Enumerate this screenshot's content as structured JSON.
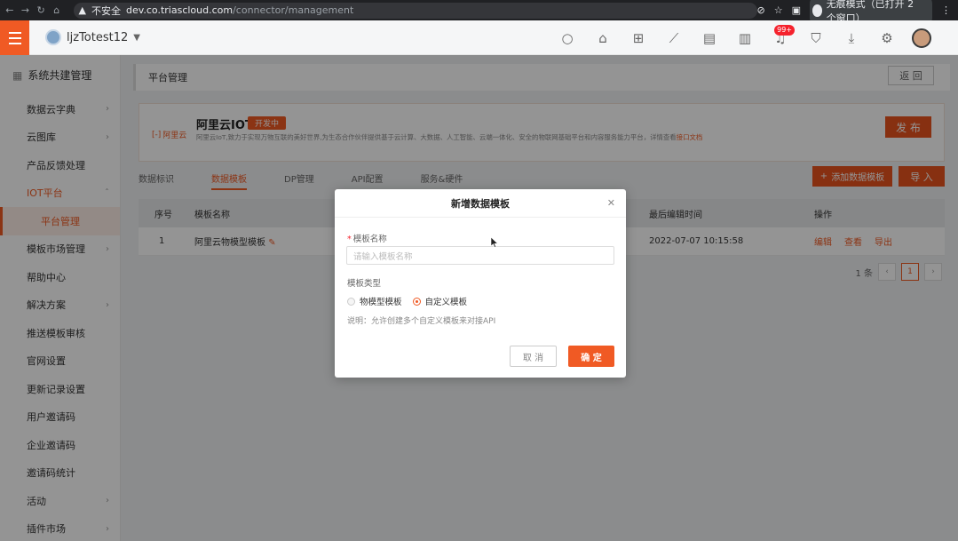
{
  "browser": {
    "back_icon": "arrow-left-icon",
    "security_label": "不安全",
    "url_host": "dev.co.triascloud.com",
    "url_path": "/connector/management",
    "incognito_label": "无痕模式（已打开 2 个窗口）"
  },
  "header": {
    "tenant_name": "ljzTotest12",
    "notification_badge": "99+"
  },
  "sidebar": {
    "title": "系统共建管理",
    "items": [
      {
        "label": "数据云字典"
      },
      {
        "label": "云图库"
      },
      {
        "label": "产品反馈处理"
      },
      {
        "label": "IOT平台"
      },
      {
        "label": "平台管理"
      },
      {
        "label": "模板市场管理"
      },
      {
        "label": "帮助中心"
      },
      {
        "label": "解决方案"
      },
      {
        "label": "推送模板审核"
      },
      {
        "label": "官网设置"
      },
      {
        "label": "更新记录设置"
      },
      {
        "label": "用户邀请码"
      },
      {
        "label": "企业邀请码"
      },
      {
        "label": "邀请码统计"
      },
      {
        "label": "活动"
      },
      {
        "label": "插件市场"
      }
    ]
  },
  "main": {
    "breadcrumb": "平台管理",
    "back_label": "返 回",
    "platform": {
      "brand": "阿里云",
      "name": "阿里云IOT",
      "status": "开发中",
      "description": "阿里云IoT,致力于实现万物互联的美好世界,为生态合作伙伴提供基于云计算、大数据、人工智能、云端一体化、安全的物联网基础平台和内容服务能力平台，详情查看",
      "doc_link": "接口文档",
      "publish_label": "发 布"
    },
    "tabs": [
      {
        "label": "数据标识"
      },
      {
        "label": "数据模板"
      },
      {
        "label": "DP管理"
      },
      {
        "label": "API配置"
      },
      {
        "label": "服务&硬件"
      }
    ],
    "add_template_label": "添加数据模板",
    "import_label": "导 入",
    "table": {
      "headers": {
        "index": "序号",
        "name": "模板名称",
        "edited": "最后编辑时间",
        "actions": "操作"
      },
      "rows": [
        {
          "index": "1",
          "name": "阿里云物模型模板",
          "edited": "2022-07-07 10:15:58",
          "edit": "编辑",
          "view": "查看",
          "export": "导出"
        }
      ]
    },
    "pagination": {
      "total": "1 条",
      "current_page": "1"
    }
  },
  "modal": {
    "title": "新增数据模板",
    "name_label": "模板名称",
    "name_placeholder": "请输入模板名称",
    "type_label": "模板类型",
    "options": [
      {
        "label": "物模型模板",
        "selected": false
      },
      {
        "label": "自定义模板",
        "selected": true
      }
    ],
    "note": "说明：允许创建多个自定义模板来对接API",
    "cancel_label": "取 消",
    "confirm_label": "确 定"
  },
  "colors": {
    "accent": "#f05a24"
  }
}
